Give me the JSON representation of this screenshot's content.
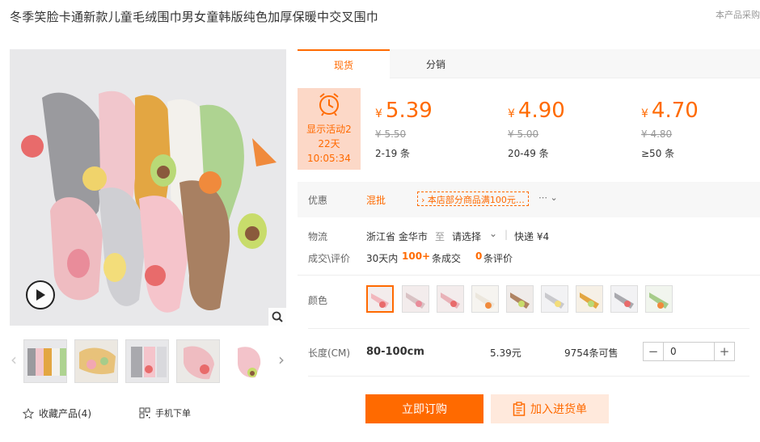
{
  "product": {
    "title": "冬季笑脸卡通新款儿童毛绒围巾男女童韩版纯色加厚保暖中交叉围巾",
    "corner_note": "本产品采购"
  },
  "gallery": {
    "play_icon": "play-icon",
    "zoom_icon": "magnifier-icon",
    "thumb_count": 5,
    "favorite_label": "收藏产品(4)",
    "mobile_order_label": "手机下单"
  },
  "tabs": [
    {
      "label": "现货",
      "active": true
    },
    {
      "label": "分销",
      "active": false
    }
  ],
  "countdown": {
    "line1": "显示活动2",
    "line2": "22天",
    "line3": "10:05:34"
  },
  "price_tiers": [
    {
      "currency": "¥",
      "price": "5.39",
      "orig": "¥ 5.50",
      "qty": "2-19 条"
    },
    {
      "currency": "¥",
      "price": "4.90",
      "orig": "¥ 5.00",
      "qty": "20-49 条"
    },
    {
      "currency": "¥",
      "price": "4.70",
      "orig": "¥ 4.80",
      "qty": "≥50 条"
    }
  ],
  "promo": {
    "label": "优惠",
    "link": "混批",
    "box": "› 本店部分商品满100元…",
    "caret": "⋯ ⌄"
  },
  "logistics": {
    "label": "物流",
    "from": "浙江省 金华市",
    "to_word": "至",
    "select": "请选择",
    "caret": "⌄",
    "express": "快递 ¥4"
  },
  "sales": {
    "label": "成交\\评价",
    "prefix": "30天内",
    "count": "100+",
    "suffix": "条成交",
    "review_count": "0",
    "review_suffix": "条评价"
  },
  "color": {
    "label": "颜色",
    "swatches": [
      "#f2b7bd",
      "#d9c2c4",
      "#e9b2b8",
      "#ece7dd",
      "#b08463",
      "#c9c9cd",
      "#e3a642",
      "#a9a9ae",
      "#a6cc8a"
    ]
  },
  "spec": {
    "label": "长度(CM)",
    "size": "80-100cm",
    "price": "5.39元",
    "stock": "9754条可售",
    "qty": "0"
  },
  "actions": {
    "buy": "立即订购",
    "cart": "加入进货单"
  },
  "colors": {
    "accent": "#ff6a00",
    "countdown_bg": "#fcd8c7",
    "cart_bg": "#ffe9dc"
  }
}
